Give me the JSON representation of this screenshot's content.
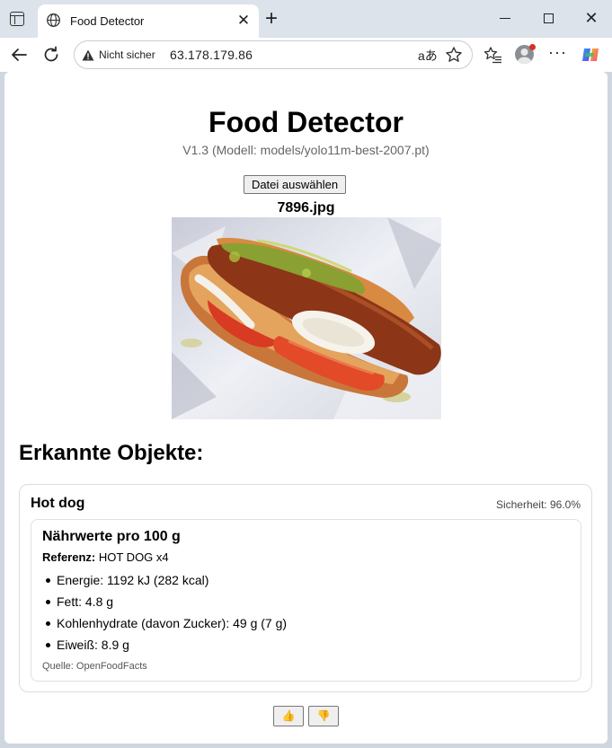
{
  "browser": {
    "tab": {
      "title": "Food Detector",
      "close_glyph": "✕"
    },
    "new_tab_glyph": "+",
    "window_close_glyph": "✕",
    "address_bar": {
      "security_label": "Nicht sicher",
      "url": "63.178.179.86",
      "read_aloud_glyph": "aあ"
    },
    "more_glyph": "···",
    "icons": [
      "tab-actions-icon",
      "globe-icon",
      "back-arrow-icon",
      "reload-icon",
      "warning-icon",
      "star-icon",
      "favorites-icon",
      "profile-avatar",
      "more-icon",
      "copilot-icon"
    ]
  },
  "page": {
    "title": "Food Detector",
    "version": "V1.3 (Modell: models/yolo11m-best-2007.pt)",
    "file_button_label": "Datei auswählen",
    "file_name": "7896.jpg",
    "results_heading": "Erkannte Objekte:",
    "detection": {
      "label": "Hot dog",
      "confidence_text": "Sicherheit: 96.0%",
      "confidence": 0.96,
      "nutrition": {
        "title": "Nährwerte pro 100 g",
        "reference_label": "Referenz:",
        "reference_value": " HOT DOG x4",
        "items": [
          "Energie: 1192 kJ (282 kcal)",
          "Fett: 4.8 g",
          "Kohlenhydrate (davon Zucker): 49 g (7 g)",
          "Eiweiß: 8.9 g"
        ],
        "source": "Quelle: OpenFoodFacts"
      }
    },
    "feedback": {
      "thumbs_up": "👍",
      "thumbs_down": "👎"
    }
  },
  "colors": {
    "titlebar": "#dde3ea",
    "page_bg": "#ffffff",
    "muted_text": "#666666",
    "card_border": "#dcdcdc"
  }
}
